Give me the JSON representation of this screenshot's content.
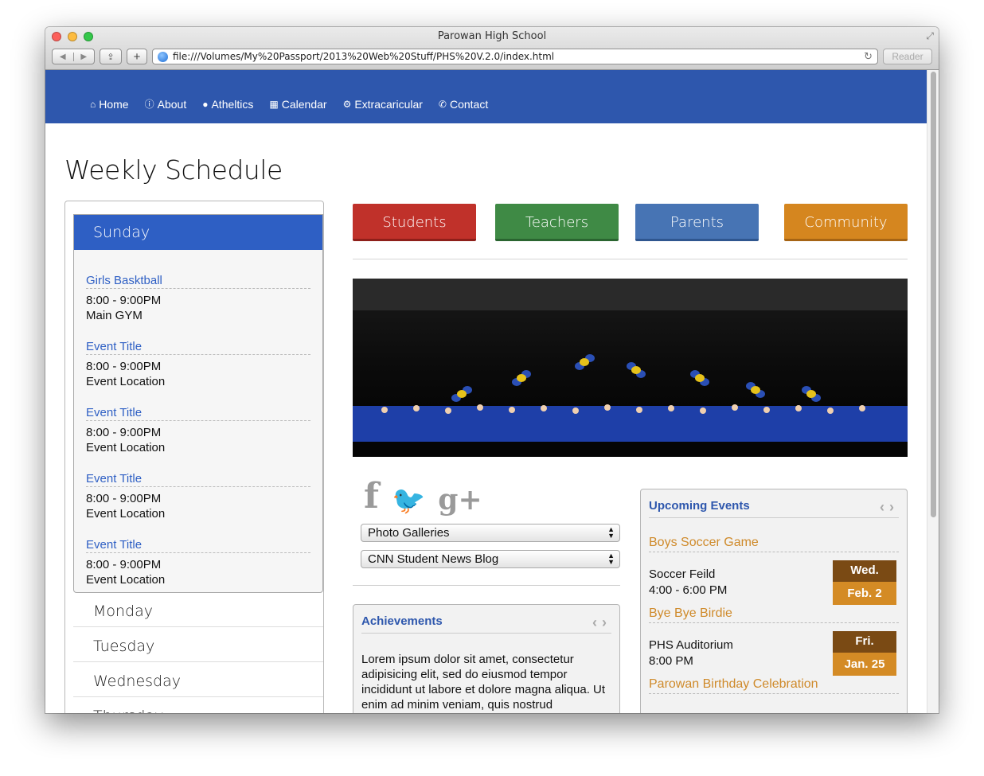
{
  "window": {
    "title": "Parowan High School",
    "url": "file:///Volumes/My%20Passport/2013%20Web%20Stuff/PHS%20V.2.0/index.html",
    "reader_label": "Reader"
  },
  "nav": {
    "items": [
      {
        "label": "Home",
        "icon": "home-icon"
      },
      {
        "label": "About",
        "icon": "info-icon"
      },
      {
        "label": "Atheltics",
        "icon": "comment-icon"
      },
      {
        "label": "Calendar",
        "icon": "calendar-icon"
      },
      {
        "label": "Extracaricular",
        "icon": "gears-icon"
      },
      {
        "label": "Contact",
        "icon": "phone-icon"
      }
    ]
  },
  "page_title": "Weekly Schedule",
  "schedule": {
    "active_day": "Sunday",
    "events": [
      {
        "title": "Girls Basktball",
        "time": "8:00 - 9:00PM",
        "location": "Main GYM"
      },
      {
        "title": "Event Title",
        "time": "8:00 - 9:00PM",
        "location": "Event Location"
      },
      {
        "title": "Event Title",
        "time": "8:00 - 9:00PM",
        "location": "Event Location"
      },
      {
        "title": "Event Title",
        "time": "8:00 - 9:00PM",
        "location": "Event Location"
      },
      {
        "title": "Event Title",
        "time": "8:00 - 9:00PM",
        "location": "Event Location"
      }
    ],
    "other_days": [
      "Monday",
      "Tuesday",
      "Wednesday",
      "Thursday"
    ]
  },
  "audience_buttons": [
    "Students",
    "Teachers",
    "Parents",
    "Community"
  ],
  "colors": {
    "nav": "#2e57ad",
    "students": "#c0312a",
    "teachers": "#3f8a45",
    "parents": "#4774b4",
    "community": "#d5861f"
  },
  "social": [
    {
      "icon": "facebook-icon",
      "glyph": "f"
    },
    {
      "icon": "twitter-icon",
      "glyph": "🐦"
    },
    {
      "icon": "google-plus-icon",
      "glyph": "g+"
    }
  ],
  "selects": [
    "Photo Galleries",
    "CNN Student News Blog"
  ],
  "achievements": {
    "title": "Achievements",
    "text": "Lorem ipsum dolor sit amet, consectetur adipisicing elit, sed do eiusmod tempor incididunt ut labore et dolore magna aliqua. Ut enim ad minim veniam, quis nostrud"
  },
  "upcoming": {
    "title": "Upcoming Events",
    "events": [
      {
        "title": "Boys Soccer Game",
        "location": "Soccer Feild",
        "time": "4:00 - 6:00 PM",
        "day": "Wed.",
        "date": "Feb. 2"
      },
      {
        "title": "Bye Bye Birdie",
        "location": "PHS Auditorium",
        "time": "8:00 PM",
        "day": "Fri.",
        "date": "Jan. 25"
      },
      {
        "title": "Parowan Birthday Celebration",
        "location": "",
        "time": "",
        "day": "",
        "date": ""
      }
    ]
  }
}
